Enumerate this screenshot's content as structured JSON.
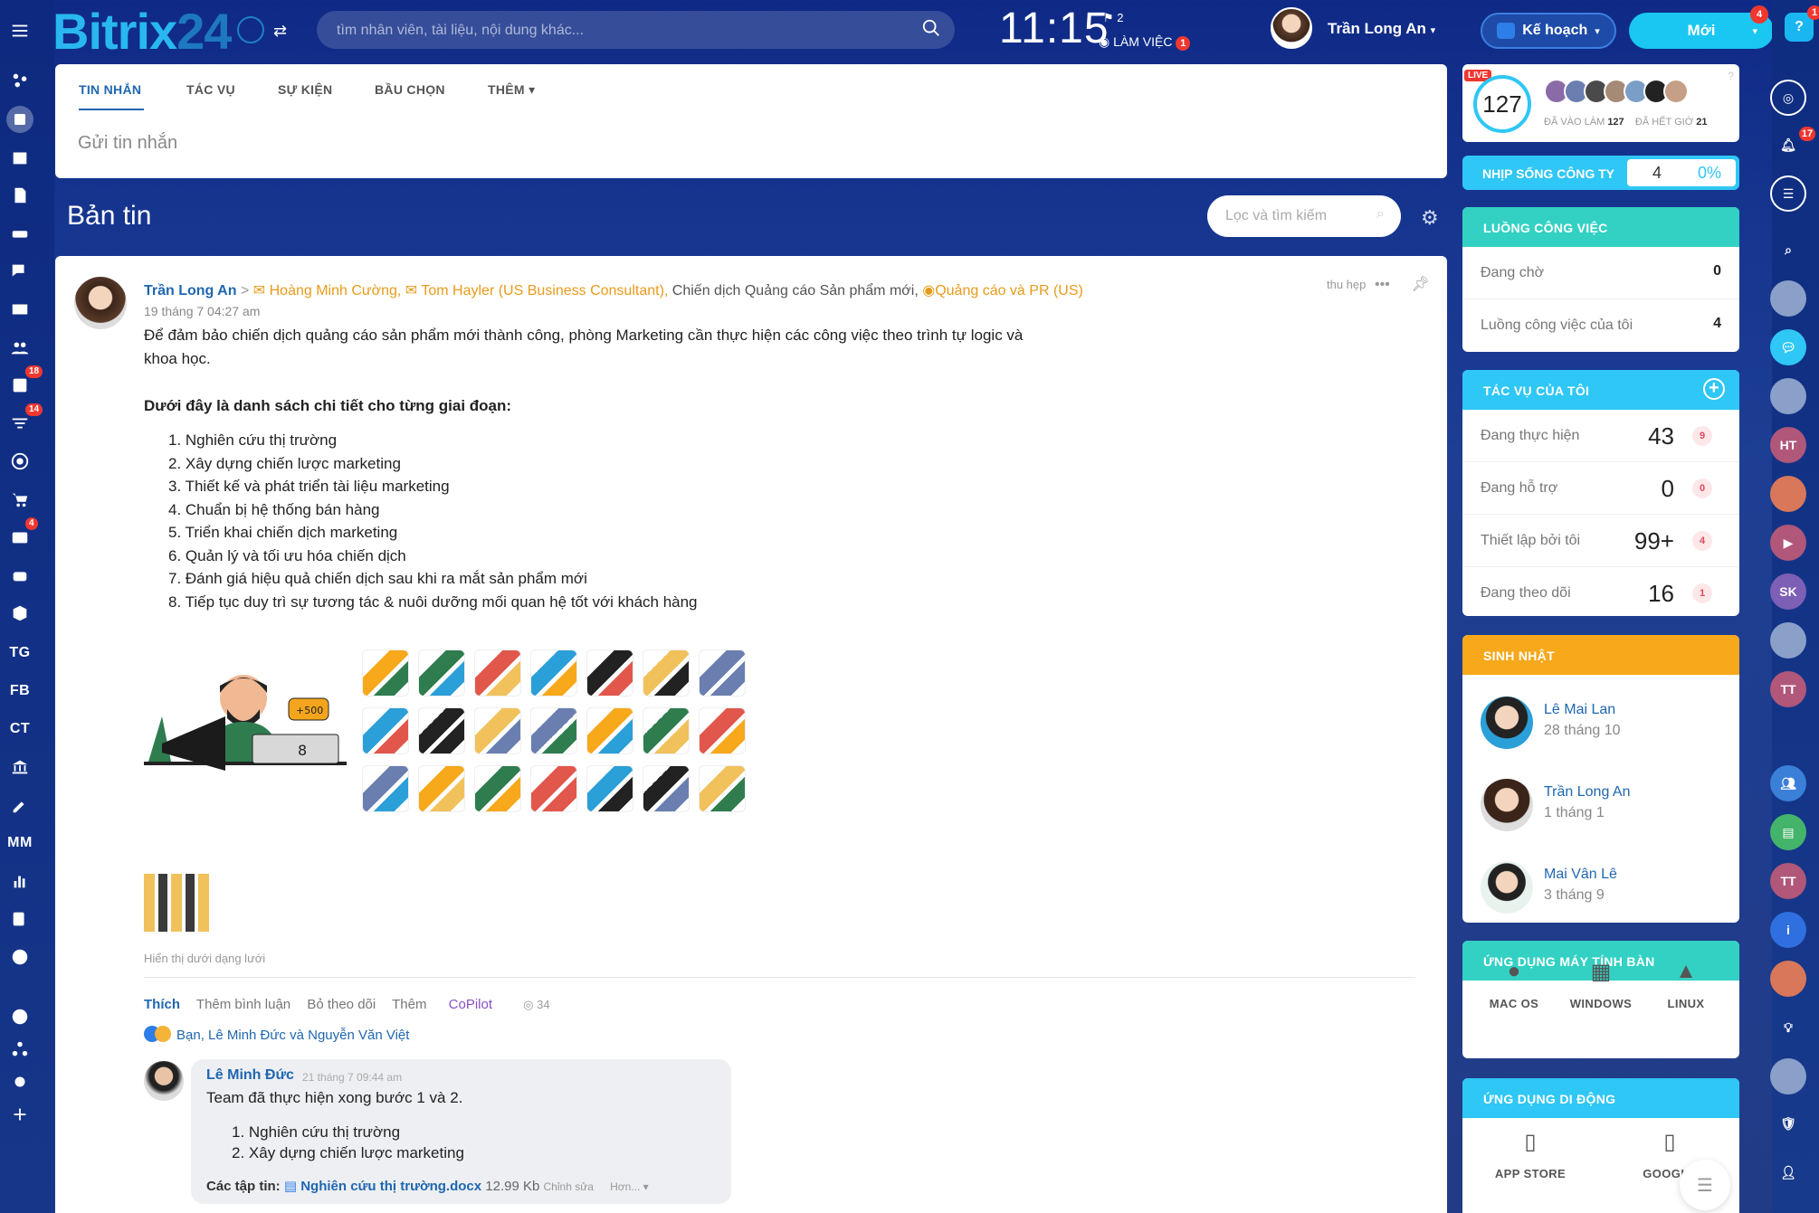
{
  "brand": {
    "logo_text": "Bitrix",
    "logo_num": "24"
  },
  "search": {
    "placeholder": "tìm nhân viên, tài liệu, nội dung khác..."
  },
  "clock": {
    "time": "11:15",
    "flag_count": "2",
    "status": "LÀM VIỆC",
    "status_badge": "1"
  },
  "user": {
    "name": "Trần Long An"
  },
  "plan_button": "Kế hoạch",
  "new_button": {
    "label": "Mới",
    "badge": "4"
  },
  "rail_badges": {
    "help": "1",
    "notify": "17"
  },
  "left_nav": {
    "badges": {
      "tasks": "18",
      "filters": "14",
      "crm": "4"
    },
    "texts": [
      "TG",
      "FB",
      "CT",
      "MM"
    ]
  },
  "composer": {
    "tabs": [
      "TIN NHẮN",
      "TÁC VỤ",
      "SỰ KIỆN",
      "BẦU CHỌN",
      "THÊM"
    ],
    "placeholder": "Gửi tin nhắn"
  },
  "feed": {
    "title": "Bản tin",
    "filter_placeholder": "Lọc và tìm kiếm"
  },
  "post": {
    "author": "Trần Long An",
    "recipients": [
      "Hoàng Minh Cường,",
      "Tom Hayler (US Business Consultant),",
      "Chiến dịch Quảng cáo Sản phẩm mới,",
      "Quảng cáo và PR (US)"
    ],
    "date": "19 tháng 7 04:27 am",
    "collapse": "thu hẹp",
    "body_1": "Để đảm bảo chiến dịch quảng cáo sản phẩm mới thành công, phòng Marketing cần thực hiện các công việc theo trình tự logic và khoa học.",
    "body_2": "Dưới đây là danh sách chi tiết cho từng giai đoạn:",
    "steps": [
      "1. Nghiên cứu thị trường",
      "2. Xây dựng chiến lược marketing",
      "3. Thiết kế và phát triển tài liệu marketing",
      "4. Chuẩn bị hệ thống bán hàng",
      "5. Triển khai chiến dịch marketing",
      "6. Quản lý và tối ưu hóa chiến dịch",
      "7. Đánh giá hiệu quả chiến dịch sau khi ra mắt sản phẩm mới",
      "8. Tiếp tục duy trì sự tương tác & nuôi dưỡng mối quan hệ tốt với khách hàng"
    ],
    "illustration_badge": "+500",
    "grid_hint": "Hiển thị dưới dạng lưới",
    "actions": {
      "like": "Thích",
      "comment": "Thêm bình luận",
      "unfollow": "Bỏ theo dõi",
      "more": "Thêm",
      "copilot": "CoPilot",
      "views": "34"
    },
    "likers": "Bạn, Lê Minh Đức và Nguyễn Văn Việt"
  },
  "comment": {
    "author": "Lê Minh Đức",
    "date": "21 tháng 7 09:44 am",
    "text": "Team đã thực hiện xong bước 1 và 2.",
    "steps": [
      "1. Nghiên cứu thị trường",
      "2. Xây dựng chiến lược marketing"
    ],
    "files_label": "Các tập tin:",
    "file_name": "Nghiên cứu thị trường.docx",
    "file_size": "12.99 Kb",
    "file_edit": "Chỉnh sửa",
    "file_more": "Hơn..."
  },
  "live_widget": {
    "live": "LIVE",
    "count": "127",
    "arrived_label": "ĐÃ VÀO LÀM",
    "arrived": "127",
    "left_label": "ĐÃ HẾT GIỜ",
    "left": "21"
  },
  "pulse": {
    "label": "NHỊP SỐNG CÔNG TY",
    "value": "4",
    "percent": "0%"
  },
  "workflow": {
    "title": "LUỒNG CÔNG VIỆC",
    "rows": [
      {
        "label": "Đang chờ",
        "value": "0"
      },
      {
        "label": "Luồng công việc của tôi",
        "value": "4"
      }
    ]
  },
  "my_tasks": {
    "title": "TÁC VỤ CỦA TÔI",
    "rows": [
      {
        "label": "Đang thực hiện",
        "value": "43",
        "badge": "9"
      },
      {
        "label": "Đang hỗ trợ",
        "value": "0",
        "badge": "0"
      },
      {
        "label": "Thiết lập bởi tôi",
        "value": "99+",
        "badge": "4"
      },
      {
        "label": "Đang theo dõi",
        "value": "16",
        "badge": "1"
      }
    ]
  },
  "birthdays": {
    "title": "SINH NHẬT",
    "people": [
      {
        "name": "Lê Mai Lan",
        "date": "28 tháng 10"
      },
      {
        "name": "Trần Long An",
        "date": "1 tháng 1"
      },
      {
        "name": "Mai Vân Lê",
        "date": "3 tháng 9"
      }
    ]
  },
  "desktop_apps": {
    "title": "ỨNG DỤNG MÁY TÍNH BÀN",
    "items": [
      "MAC OS",
      "WINDOWS",
      "LINUX"
    ]
  },
  "mobile_apps": {
    "title": "ỨNG DỤNG DI ĐỘNG",
    "items": [
      "APP STORE",
      "GOOGLE"
    ]
  },
  "rail_initials": [
    "HT",
    "SK",
    "TT",
    "TT"
  ],
  "colors": {
    "accent": "#2067b0",
    "sky": "#2fc7f5",
    "teal": "#33d1c3",
    "orange": "#f7a81b",
    "badge": "#f0372f"
  }
}
